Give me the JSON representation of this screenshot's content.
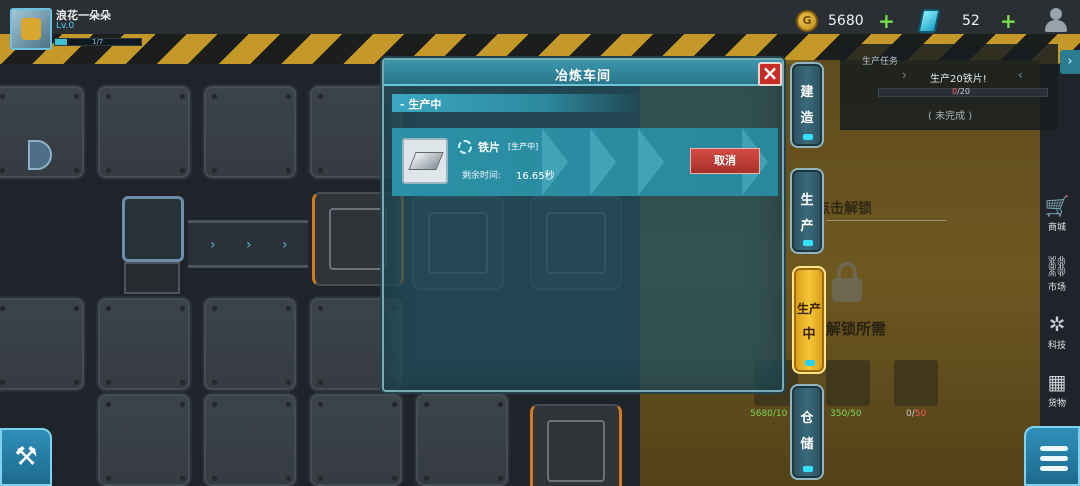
{
  "player": {
    "name": "浪花一朵朵",
    "level": "Lv.0",
    "xp_text": "1/7",
    "xp_fraction": 0.14
  },
  "resources": {
    "coins": "5680",
    "gems": "52"
  },
  "task_panel": {
    "title": "生产任务",
    "task_name": "生产20铁片!",
    "progress_current": "0",
    "progress_total": "/20",
    "progress_fraction": 0,
    "status": "( 未完成 )"
  },
  "dialog": {
    "title": "冶炼车间",
    "section_title": "- 生产中",
    "production": {
      "item_name": "铁片",
      "item_status": "[生产中]",
      "time_label": "剩余时间:",
      "time_value": "16.65秒",
      "cancel_label": "取消"
    }
  },
  "side_tabs": [
    {
      "label_top": "建",
      "label_bottom": "造",
      "active": false
    },
    {
      "label_top": "生",
      "label_bottom": "产",
      "active": false
    },
    {
      "label_top": "生产",
      "label_bottom": "中",
      "active": true
    },
    {
      "label_top": "仓",
      "label_bottom": "储",
      "active": false
    }
  ],
  "right_sidebar": [
    {
      "label": "商城",
      "icon": "cart-icon"
    },
    {
      "label": "市场",
      "icon": "market-icon"
    },
    {
      "label": "科技",
      "icon": "tech-icon"
    },
    {
      "label": "货物",
      "icon": "crate-icon"
    }
  ],
  "locked_area": {
    "unlock_text": "点击解锁",
    "requirement_text": "解锁所需",
    "requirements": [
      {
        "value": "5680/10",
        "color": "#7bd85a"
      },
      {
        "value": "350/50",
        "color": "#7bd85a"
      },
      {
        "value": "0/",
        "value_red": "50",
        "color": "#c9c9c9"
      }
    ]
  },
  "colors": {
    "accent": "#2a8aa0",
    "close": "#c72c26",
    "cancel": "#c43b35",
    "active_tab": "#f5c53a",
    "gem": "#35e0ff"
  }
}
